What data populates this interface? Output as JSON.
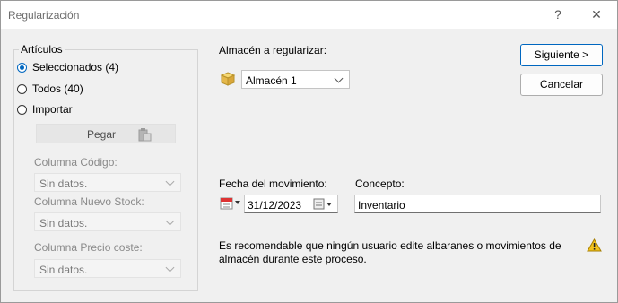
{
  "window": {
    "title": "Regularización",
    "help_label": "?",
    "close_label": "✕"
  },
  "articulos": {
    "legend": "Artículos",
    "options": [
      {
        "label": "Seleccionados (4)",
        "selected": true
      },
      {
        "label": "Todos (40)",
        "selected": false
      },
      {
        "label": "Importar",
        "selected": false
      }
    ],
    "pegar_label": "Pegar",
    "columna_codigo": {
      "label": "Columna Código:",
      "value": "Sin datos."
    },
    "columna_stock": {
      "label": "Columna Nuevo Stock:",
      "value": "Sin datos."
    },
    "columna_precio": {
      "label": "Columna Precio coste:",
      "value": "Sin datos."
    }
  },
  "almacen": {
    "label": "Almacén a regularizar:",
    "value": "Almacén 1"
  },
  "fecha": {
    "label": "Fecha del movimiento:",
    "value": "31/12/2023"
  },
  "concepto": {
    "label": "Concepto:",
    "value": "Inventario"
  },
  "buttons": {
    "next": "Siguiente >",
    "cancel": "Cancelar"
  },
  "note": "Es recomendable que ningún usuario edite albaranes o movimientos de almacén durante este proceso.",
  "colors": {
    "accent": "#0067c0",
    "warning": "#f2c21b"
  }
}
